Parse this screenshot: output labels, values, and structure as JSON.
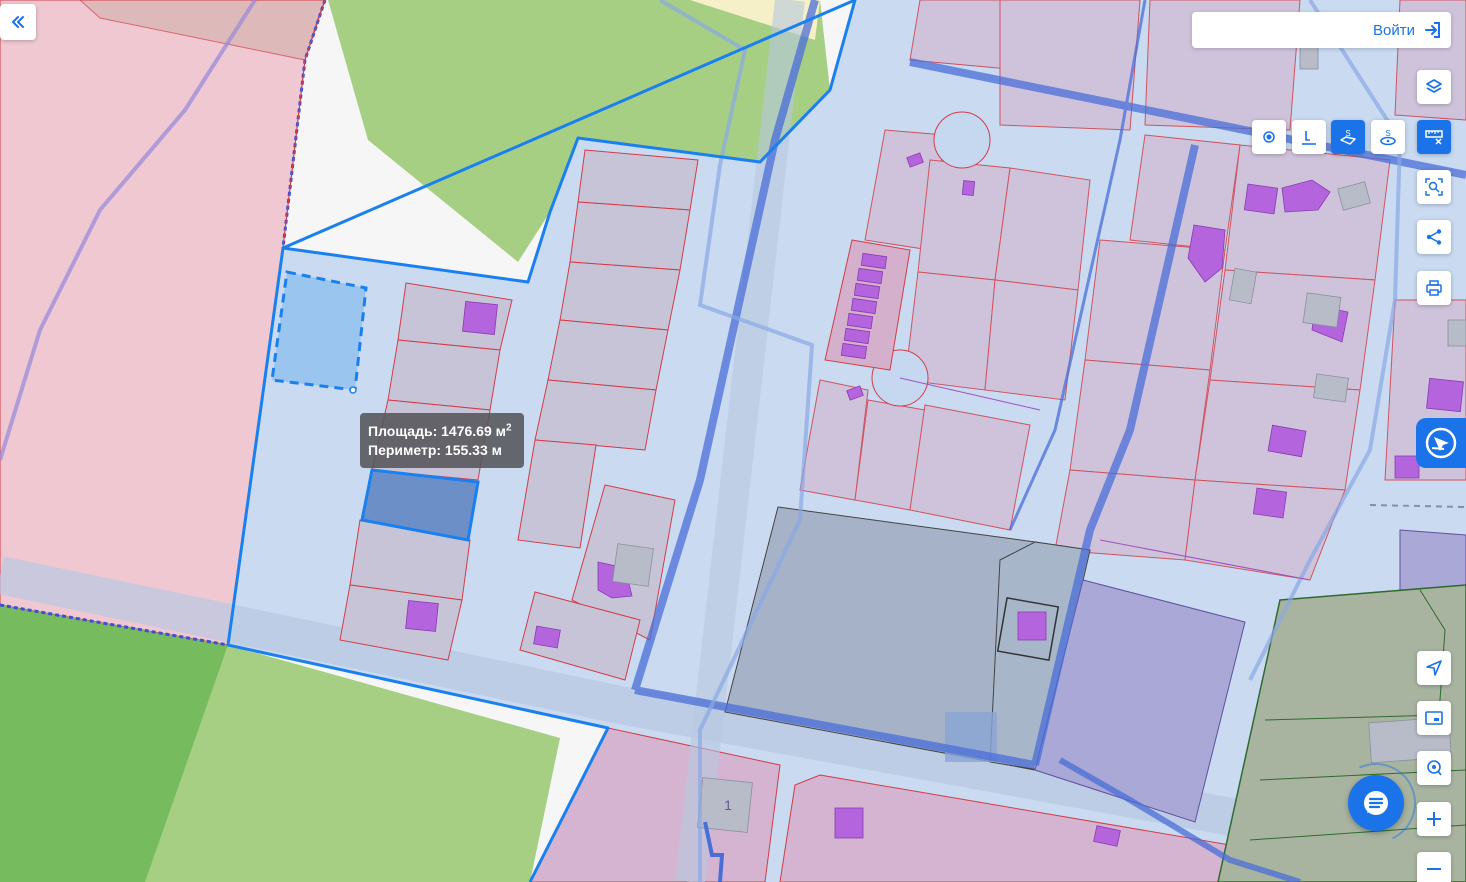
{
  "header": {
    "login_label": "Войти"
  },
  "measurement": {
    "area_label": "Площадь: 1476.69 м",
    "area_unit_exp": "2",
    "perimeter_label": "Периметр: 155.33 м"
  },
  "map_labels": {
    "plot_number": "1"
  },
  "toolbar": {
    "measure_modes": [
      {
        "name": "point-mode",
        "icon": "dot-icon",
        "active": false
      },
      {
        "name": "line-mode",
        "icon": "ruler-l-icon",
        "active": false
      },
      {
        "name": "area-mode",
        "icon": "area-s-icon",
        "active": true
      },
      {
        "name": "circle-area-mode",
        "icon": "circle-s-icon",
        "active": false
      }
    ]
  },
  "colors": {
    "accent": "#1a73e8",
    "measure_outline": "#1a80f0",
    "parcel_line": "#d23c46",
    "building": "#b464dc",
    "zone_pink": "#f0c8d2",
    "zone_green": "#a6cf84",
    "zone_blue": "#c6d8f0"
  }
}
